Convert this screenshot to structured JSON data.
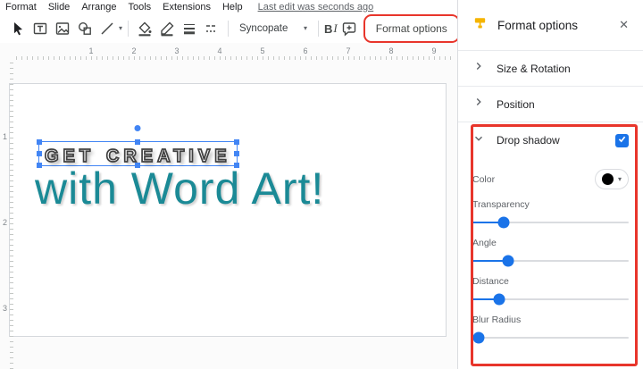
{
  "menubar": {
    "items": [
      "Format",
      "Slide",
      "Arrange",
      "Tools",
      "Extensions",
      "Help"
    ],
    "last_edit": "Last edit was seconds ago"
  },
  "toolbar": {
    "font_name": "Syncopate",
    "bold": "B",
    "italic": "I",
    "format_options": "Format options",
    "more": "⋯"
  },
  "ruler": {
    "h_marks": [
      "1",
      "2",
      "3",
      "4",
      "5",
      "6",
      "7",
      "8",
      "9"
    ],
    "v_marks": [
      "1",
      "2",
      "3"
    ]
  },
  "slide": {
    "line1": "get creative",
    "line2": "with Word Art!"
  },
  "panel": {
    "title": "Format options",
    "close": "✕",
    "size_rotation": "Size & Rotation",
    "position": "Position",
    "drop_shadow": {
      "label": "Drop shadow",
      "enabled": true,
      "color_label": "Color",
      "sliders": [
        {
          "label": "Transparency",
          "pct": 20
        },
        {
          "label": "Angle",
          "pct": 23
        },
        {
          "label": "Distance",
          "pct": 17
        },
        {
          "label": "Blur Radius",
          "pct": 4
        }
      ]
    }
  },
  "colors": {
    "accent_blue": "#1a73e8",
    "selection_blue": "#4285f4",
    "annotation_red": "#e8352b",
    "wordart_teal": "#1b8a96",
    "shadow_color_swatch": "#000000",
    "panel_icon_yellow": "#f5b400"
  }
}
